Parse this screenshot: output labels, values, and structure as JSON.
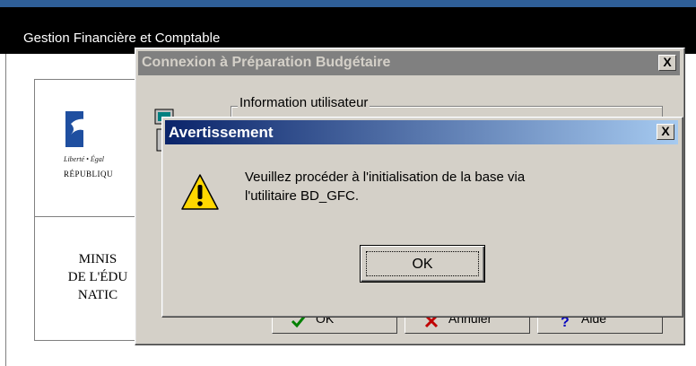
{
  "app": {
    "title": "Gestion Financière et Comptable",
    "logo": {
      "motto": "Liberté • Égal",
      "republic": "RÉPUBLIQU",
      "ministry_lines": [
        "MINIS",
        "DE L'ÉDU",
        "NATIC"
      ]
    }
  },
  "connexion_dialog": {
    "title": "Connexion à Préparation Budgétaire",
    "close_label": "X",
    "group_label": "Information utilisateur",
    "buttons": [
      {
        "label": "OK",
        "icon": "checkmark-icon"
      },
      {
        "label": "Annuler",
        "icon": "cross-icon"
      },
      {
        "label": "Aide",
        "icon": "help-icon"
      }
    ]
  },
  "alert_dialog": {
    "title": "Avertissement",
    "close_label": "X",
    "icon": "warning-icon",
    "message_lines": [
      "Veuillez procéder à l'initialisation de la base via",
      "l'utilitaire BD_GFC."
    ],
    "ok_label": "OK"
  },
  "colors": {
    "active_title_start": "#0a246a",
    "active_title_end": "#a6caf0",
    "inactive_title": "#808080",
    "dialog_face": "#d4d0c8"
  }
}
